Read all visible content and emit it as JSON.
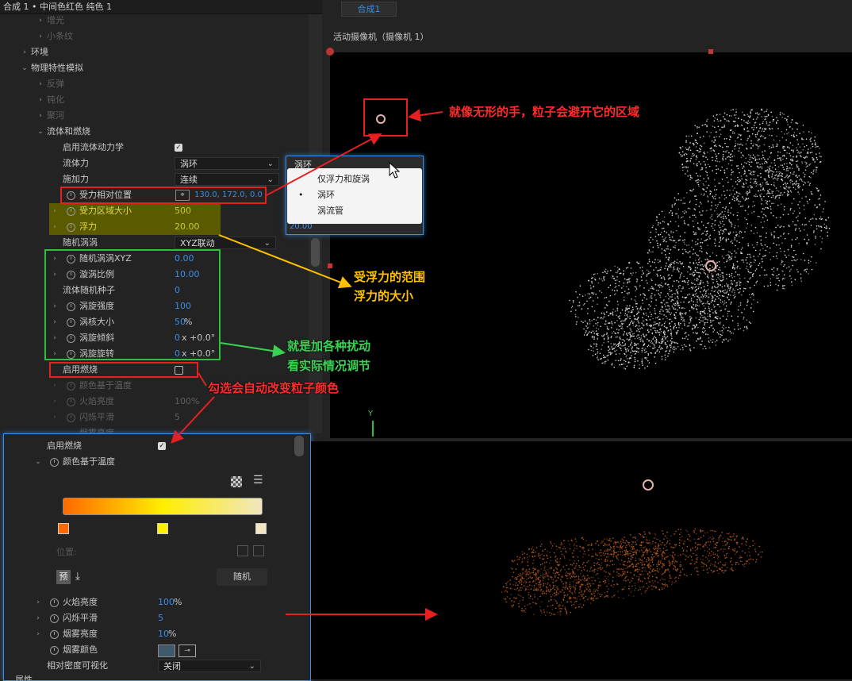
{
  "header": {
    "title": "合成 1 • 中间色红色 纯色 1"
  },
  "effect_tree": {
    "rows": [
      {
        "label": "增光",
        "indent": 46,
        "arrow": "›",
        "dim": true
      },
      {
        "label": "小条纹",
        "indent": 46,
        "arrow": "›",
        "dim": true
      },
      {
        "label": "环境",
        "indent": 26,
        "arrow": "›"
      },
      {
        "label": "物理特性模拟",
        "indent": 26,
        "arrow": "⌄"
      },
      {
        "label": "反弹",
        "indent": 46,
        "arrow": "›",
        "dim": true
      },
      {
        "label": "钝化",
        "indent": 46,
        "arrow": "›",
        "dim": true
      },
      {
        "label": "聚河",
        "indent": 46,
        "arrow": "›",
        "dim": true
      },
      {
        "label": "流体和燃烧",
        "indent": 46,
        "arrow": "⌄"
      }
    ],
    "enable_fluid_label": "启用流体动力学",
    "fluid_force_label": "流体力",
    "fluid_force_value": "涡环",
    "apply_force_label": "施加力",
    "apply_force_value": "连续",
    "force_pos_label": "受力相对位置",
    "force_pos_value": "130.0, 172.0, 0.0",
    "force_area_label": "受力区域大小",
    "force_area_value": "500",
    "buoyancy_label": "浮力",
    "buoyancy_value": "20.00",
    "random_vortex_label": "随机涡涡",
    "random_vortex_value": "XYZ联动",
    "rand_vortex_xyz_label": "随机涡涡XYZ",
    "rand_vortex_xyz_value": "0.00",
    "vortex_scale_label": "漩涡比例",
    "vortex_scale_value": "10.00",
    "fluid_seed_label": "流体随机种子",
    "fluid_seed_value": "0",
    "swirl_strength_label": "涡旋强度",
    "swirl_strength_value": "100",
    "core_size_label": "涡核大小",
    "core_size_value": "50",
    "core_size_unit": "%",
    "swirl_tilt_label": "涡旋倾斜",
    "swirl_tilt_prefix": "0",
    "swirl_tilt_value": "x +0.0°",
    "swirl_rot_label": "涡旋旋转",
    "swirl_rot_prefix": "0",
    "swirl_rot_value": "x +0.0°",
    "enable_burn_label": "启用燃烧",
    "color_temp_label": "颜色基于温度",
    "flame_brightness_label": "火焰亮度",
    "flame_brightness_value": "100%",
    "flicker_label": "闪烁平滑",
    "flicker_value": "5",
    "smoke_label": "烟雾亮度"
  },
  "popup": {
    "field_value": "涡环",
    "field_value_below": "20.00",
    "options": [
      "仅浮力和旋涡",
      "涡环",
      "涡流管"
    ],
    "selected_index": 1
  },
  "composition": {
    "tab_label": "合成1",
    "camera_label": "活动摄像机（摄像机 1）",
    "axis_label": "Y"
  },
  "bottom_panel": {
    "enable_burn_label": "启用燃烧",
    "color_temp_label": "颜色基于温度",
    "position_label": "位置:",
    "preset_label": "预设",
    "random_label": "随机",
    "flame_brightness_label": "火焰亮度",
    "flame_brightness_value": "100",
    "flame_brightness_unit": "%",
    "flicker_label": "闪烁平滑",
    "flicker_value": "5",
    "smoke_brightness_label": "烟雾亮度",
    "smoke_brightness_value": "10",
    "smoke_brightness_unit": "%",
    "smoke_color_label": "烟雾颜色",
    "density_vis_label": "相对密度可视化",
    "density_vis_value": "关闭",
    "truncated_label": "属性",
    "gradient_colors": [
      "#ff6a00",
      "#ffee00",
      "#f1e6c0"
    ]
  },
  "annotations": {
    "invisible_hand": "就像无形的手，粒子会避开它的区域",
    "buoyancy_range": "受浮力的范围",
    "buoyancy_size": "浮力的大小",
    "disturbance_1": "就是加各种扰动",
    "disturbance_2": "看实际情况调节",
    "burn_note": "勾选会自动改变粒子颜色"
  },
  "colors": {
    "accent": "#3a8ee6",
    "annotation_red": "#ff2a2a",
    "annotation_yellow": "#ffc000",
    "annotation_green": "#39d353",
    "highlight_yellow": "#5a5a00"
  }
}
